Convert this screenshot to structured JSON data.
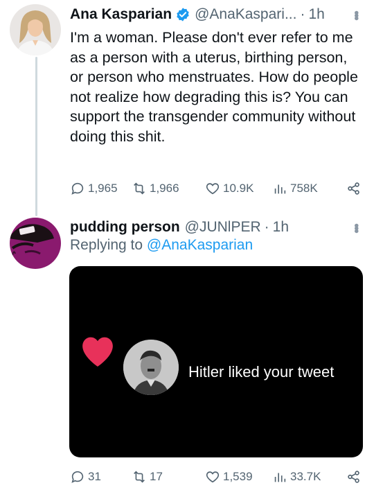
{
  "tweet1": {
    "author_name": "Ana Kasparian",
    "handle": "@AnaKaspari...",
    "separator": "·",
    "time": "1h",
    "text": "I'm a woman. Please don't ever refer to me as a person with a uterus, birthing person, or person who menstruates. How do people not realize how degrading this is? You can support the transgender community without doing this shit.",
    "replies": "1,965",
    "retweets": "1,966",
    "likes": "10.9K",
    "views": "758K"
  },
  "tweet2": {
    "author_name": "pudding person",
    "handle": "@JUNlPER",
    "separator": "·",
    "time": "1h",
    "replying_prefix": "Replying to",
    "replying_handle": "@AnaKasparian",
    "media_caption": "Hitler liked your tweet",
    "replies": "31",
    "retweets": "17",
    "likes": "1,539",
    "views": "33.7K"
  },
  "colors": {
    "text": "#0f1419",
    "secondary": "#536471",
    "link": "#1d9bf0",
    "verified": "#1d9bf0",
    "heart": "#e8315a",
    "avatar2_bg": "#8a1a6e"
  },
  "icons": [
    "verified-badge-icon",
    "more-icon",
    "reply-icon",
    "retweet-icon",
    "like-icon",
    "views-icon",
    "share-icon",
    "heart-icon"
  ]
}
